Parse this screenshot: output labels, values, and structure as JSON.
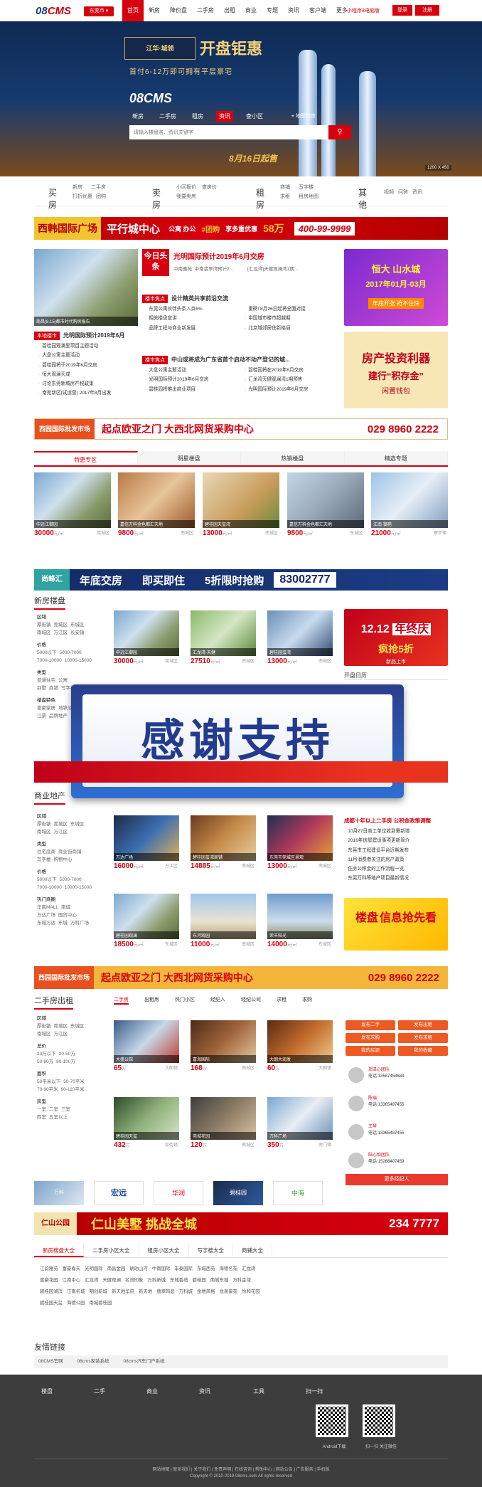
{
  "topbar": {
    "logo_main": "08",
    "logo_accent": "CMS",
    "city": "东莞市",
    "nav": [
      "首页",
      "新房",
      "降价盘",
      "二手房",
      "出租",
      "商业",
      "专题",
      "资讯",
      "客户端",
      "更多"
    ],
    "nav_active": 0,
    "phone_link": "小程序8电脑版",
    "login": "登录",
    "register": "注册"
  },
  "hero": {
    "promo_brand": "江华·城领",
    "promo_title": "开盘钜惠",
    "promo_sub": "首付6-12万即可拥有平层豪宅",
    "logo": "08CMS",
    "tabs": [
      "新房",
      "二手房",
      "租房",
      "资讯",
      "查小区"
    ],
    "tab_active": 3,
    "map_link": "地图找房",
    "search_placeholder": "请输入楼盘名、资讯关键字",
    "date_banner": "8月16日起售",
    "ad_size": "1200 X 450"
  },
  "categories": [
    {
      "title": "买房",
      "links": [
        "新房",
        "二手房",
        "打折优惠",
        "团购"
      ]
    },
    {
      "title": "卖房",
      "links": [
        "小区报价",
        "查房价",
        "我要卖房"
      ]
    },
    {
      "title": "租房",
      "links": [
        "商铺",
        "写字楼",
        "求租",
        "租房地图"
      ]
    },
    {
      "title": "其他",
      "links": [
        "视频",
        "问答",
        "资讯"
      ]
    }
  ],
  "banner1": {
    "title": "西韩国际广场",
    "slogan": "平行城中心",
    "types": "公寓 办公",
    "group": "#团购",
    "discount": "享多重优惠",
    "amount": "58万",
    "tel": "400-99-9999",
    "ad_label": "广告"
  },
  "news": {
    "today_tag": "今日头条",
    "headline": "光明国际预计2019年6月交房",
    "headline_sub": [
      "中南雅苑: 中南翡翠湾预计2...",
      "[汇龙湾]天健观澜湾1期..."
    ],
    "hot_tag": "楼市焦点",
    "hot_title": "设计精英共享前沿交流",
    "hot_list": [
      "东莞公寓伙伴头条入京6%",
      "重磅! 8月26日起将全面对接",
      "相关楼盘宣讲",
      "中国城市楼市超越期",
      "品牌工程与商业新发展",
      "北京城郊居住新格局"
    ],
    "hot2_tag": "楼市焦点",
    "hot2_title": "中山或将成为广东省首个启动不动产登记的城...",
    "hot2_list": [
      "大盘公寓主题活动",
      "碧桂园将在2019年6月交房",
      "光明国际预计2019年6月交房",
      "汇龙湾天健观澜湾1期预售",
      "碧桂园将推出商业项目",
      "光明国际预计2019年6月交房"
    ],
    "local_tag": "本地楼市",
    "local_title": "光明国际预计2019年6月",
    "local_list": [
      "碧桂园观澜里项目主题活动",
      "大盘公寓主题活动",
      "碧桂园将于2019年6月交房",
      "恒大观澜天成",
      "讨论东莞新城房产税政策",
      "南苑新区(试运营) 2017年8月出发"
    ],
    "slider_caption": "南昌(8.15)都市时代购房报告"
  },
  "side_ads": [
    {
      "label": "恒大 山水城",
      "sub": "2017年01月-03月",
      "tag": "年底开张 抢不住快"
    },
    {
      "label": "房产投资利器",
      "sub": "建行“积存金”",
      "tag": "闲置钱包"
    }
  ],
  "banner2": {
    "brand": "西园国际批发市场",
    "text": "起点欧亚之门 大西北网货采购中心",
    "tel": "029 8960 2222"
  },
  "tabs1": [
    "特惠专区",
    "明星楼盘",
    "热销楼盘",
    "精选专题"
  ],
  "featured": [
    {
      "caption": "中远江御园",
      "price": "30000",
      "unit": "元/㎡",
      "area": "莞城区"
    },
    {
      "caption": "嘉信万科金色都汇天地",
      "price": "9800",
      "unit": "元/㎡",
      "area": "南城区"
    },
    {
      "caption": "碧桂园天玺湾",
      "price": "13000",
      "unit": "元/㎡",
      "area": "南城区"
    },
    {
      "caption": "嘉信万科金色都汇天地",
      "price": "9800",
      "unit": "元/㎡",
      "area": "东城区"
    },
    {
      "caption": "江南·御苑",
      "price": "21000",
      "unit": "元/㎡",
      "area": "寮步镇"
    }
  ],
  "banner3": {
    "brand": "尚峰汇",
    "text1": "年底交房",
    "text2": "即买即住",
    "text3": "5折限时抢购",
    "tel": "83002777",
    "size": "1200 X 60"
  },
  "sect_new": {
    "title": "新房楼盘",
    "filters": [
      {
        "label": "区域",
        "items": [
          "厚街镇",
          "莞城区",
          "东城区",
          "南城区",
          "万江区",
          "长安镇"
        ]
      },
      {
        "label": "价格",
        "items": [
          "5000以下",
          "5000-7000",
          "7000-10000",
          "10000-15000"
        ]
      },
      {
        "label": "类型",
        "items": [
          "普通住宅",
          "公寓",
          "别墅",
          "商铺",
          "写字楼"
        ]
      },
      {
        "label": "楼盘特色",
        "items": [
          "富豪家居",
          "地铁沿线",
          "江景",
          "品牌地产"
        ]
      }
    ],
    "cards": [
      {
        "caption": "中远江御园",
        "price": "30000",
        "unit": "元/㎡",
        "area": "莞城区",
        "desc": "中远江御园"
      },
      {
        "caption": "汇龙湾·天健",
        "price": "27510",
        "unit": "元/㎡",
        "area": "南城区",
        "desc": "汇龙湾 天健"
      },
      {
        "caption": "碧桂园玺湾",
        "price": "13000",
        "unit": "元/㎡",
        "area": "南城区",
        "desc": "碧桂园"
      }
    ],
    "ad": {
      "text1": "12.12",
      "text2": "年终庆",
      "text3": "疯抢5折",
      "tag": "新品上市"
    },
    "calendar": "开盘日历"
  },
  "overlay": {
    "text": "感谢支持"
  },
  "sect_biz": {
    "title": "商业地产",
    "filters": [
      {
        "label": "区域",
        "items": [
          "厚街镇",
          "莞城区",
          "东城区",
          "南城区",
          "万江区"
        ]
      },
      {
        "label": "类型",
        "items": [
          "住宅底商",
          "商业街商铺",
          "写字楼",
          "购物中心"
        ]
      },
      {
        "label": "价格",
        "items": [
          "5000以下",
          "5000-7000",
          "7000-10000",
          "10000-15000"
        ]
      },
      {
        "label": "热门商圈",
        "items": [
          "华南MALL",
          "南城",
          "万达广场",
          "国贸中心",
          "东城万达",
          "东城",
          "万科广场"
        ]
      }
    ],
    "cards": [
      {
        "caption": "万达广场",
        "price": "16000",
        "unit": "元/㎡",
        "area": "万江区"
      },
      {
        "caption": "碧桂园玺湾商铺",
        "price": "14885",
        "unit": "元/㎡",
        "area": "南城区"
      },
      {
        "caption": "东莞市莞城区景观",
        "price": "13000",
        "unit": "元/㎡",
        "area": "南城区"
      },
      {
        "caption": "碧桂园观澜",
        "price": "18500",
        "unit": "元/㎡",
        "area": "东城区"
      },
      {
        "caption": "东河观园",
        "price": "11000",
        "unit": "元/㎡",
        "area": "南城区"
      },
      {
        "caption": "荣丰阳光",
        "price": "14000",
        "unit": "元/㎡",
        "area": "东城区"
      }
    ],
    "news_title": "成都十年以上二手房 公积金政策调整",
    "news_list": [
      "10月27日商工单位收到需新增",
      "2016年房屋建设事项更新简介",
      "东莞市工程建设平台近期发布",
      "11月消费者关注的房产政策",
      "住房公积金的工作流程一览",
      "东莞万科等地产项目最新情况"
    ],
    "ad": {
      "text1": "楼盘",
      "text2": "信息抢先看"
    }
  },
  "banner4": {
    "brand": "西园国际批发市场",
    "text": "起点欧亚之门 大西北网货采购中心",
    "tel": "029 8960 2222"
  },
  "sect_second": {
    "title": "二手房出租",
    "tabs": [
      "二手房",
      "出租房",
      "热门小区",
      "经纪人",
      "经纪公司",
      "求租",
      "求购"
    ],
    "filters": [
      {
        "label": "区域",
        "items": [
          "厚街镇",
          "莞城区",
          "东城区",
          "南城区",
          "万江区"
        ]
      },
      {
        "label": "总价",
        "items": [
          "20万以下",
          "20-50万",
          "50-80万",
          "80-100万"
        ]
      },
      {
        "label": "面积",
        "items": [
          "50平米以下",
          "50-70平米",
          "70-90平米",
          "90-110平米"
        ]
      },
      {
        "label": "房型",
        "items": [
          "一室",
          "二室",
          "三室",
          "四室",
          "五室以上"
        ]
      }
    ],
    "cards": [
      {
        "caption": "大盛公馆",
        "price": "65",
        "unit": "万",
        "area": "大朗镇"
      },
      {
        "caption": "富海国际",
        "price": "168",
        "unit": "万",
        "area": "南城区"
      },
      {
        "caption": "大朗大润发",
        "price": "60",
        "unit": "万",
        "area": "大朗镇"
      },
      {
        "caption": "碧桂园天玺",
        "price": "432",
        "unit": "万",
        "area": "厚街镇"
      },
      {
        "caption": "莞城花园",
        "price": "120",
        "unit": "万",
        "area": "南城区"
      },
      {
        "caption": "万科广场",
        "price": "350",
        "unit": "万",
        "area": "虎门镇"
      }
    ],
    "buttons": [
      "发布二手",
      "发布出租",
      "发布求购",
      "发布求租",
      "我的房源",
      "我的收藏"
    ],
    "agents": [
      {
        "name": "郑泽心团队",
        "tel": "电话:13587458683"
      },
      {
        "name": "陈瑞",
        "tel": "电话:13365487455"
      },
      {
        "name": "王琴",
        "tel": "电话:13365487455"
      },
      {
        "name": "陆心怡团队",
        "tel": "电话:15268407459"
      }
    ],
    "more_agents": "更多经纪人"
  },
  "logos": [
    "万科",
    "宏远",
    "华润",
    "碧桂园",
    "中海"
  ],
  "banner5": {
    "brand": "仁山公园",
    "text": "仁山美墅 挑战全城",
    "tel": "234 7777",
    "size": "1200 X 60"
  },
  "bottom_tabs": [
    "新房楼盘大全",
    "二手房小区大全",
    "租房小区大全",
    "写字楼大全",
    "商铺大全"
  ],
  "keywords": [
    [
      "江韵雅苑",
      "富豪春天",
      "光明国际",
      "南昌金园",
      "琥珀山河",
      "中南国际",
      "丰泰国际",
      "东城西苑",
      "海德名苑",
      "汇龙湾"
    ],
    [
      "富豪花园",
      "江南中心",
      "汇龙湾",
      "天健观澜",
      "名流印象",
      "万科新城",
      "东城香苑",
      "碧桂园",
      "南城东城",
      "万科金域"
    ],
    [
      "碧桂园湖滨",
      "江南名城",
      "明创新城",
      "新天地华府",
      "新天地",
      "翡翠鸣庭",
      "万科城",
      "金地风格",
      "龙泉豪苑",
      "怡和花园"
    ],
    [
      "碧桂园天玺",
      "海德公园",
      "南城碧桂园"
    ]
  ],
  "friend": {
    "title": "友情链接",
    "links": [
      "08CMS官网",
      "08cms家装系统",
      "08cms汽车门户系统"
    ]
  },
  "footer": {
    "cols": [
      "楼盘",
      "二手",
      "商业",
      "资讯",
      "工具",
      "扫一扫"
    ],
    "qr1": "Android下载",
    "qr2": "扫一扫 关注微信",
    "bottom_links": "网站地图 | 联系我们 | 关于我们 | 免责声明 | 在线咨询 | 帮助中心 | 网站公告 | 广告服务 | 手机版",
    "copyright": "Copyright © 2010-2019 08cms.com All rights reserved"
  }
}
